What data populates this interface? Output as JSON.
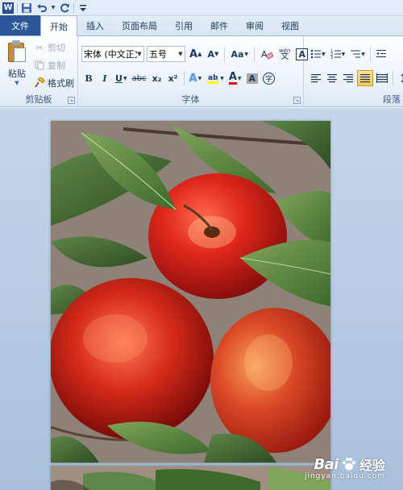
{
  "qat": {
    "app_letter": "W"
  },
  "tabs": [
    {
      "label": "文件"
    },
    {
      "label": "开始"
    },
    {
      "label": "插入"
    },
    {
      "label": "页面布局"
    },
    {
      "label": "引用"
    },
    {
      "label": "邮件"
    },
    {
      "label": "审阅"
    },
    {
      "label": "视图"
    }
  ],
  "clipboard": {
    "paste_label": "粘贴",
    "cut_label": "剪切",
    "copy_label": "复制",
    "format_painter_label": "格式刷",
    "group_label": "剪贴板"
  },
  "font": {
    "font_name": "宋体 (中文正文",
    "font_size": "五号",
    "grow": "A",
    "shrink": "A",
    "change_case": "Aa",
    "pinyin": "wén",
    "bold": "B",
    "italic": "I",
    "underline": "U",
    "strike": "abc",
    "subscript": "x₂",
    "superscript": "x²",
    "text_effects": "A",
    "font_color": "A",
    "char_shading": "A",
    "enclose": "字",
    "group_label": "字体"
  },
  "paragraph": {
    "group_label": "段落"
  },
  "watermark": {
    "brand": "Bai",
    "brand_cn": "经验",
    "sub": "jingyan.baidu.com"
  },
  "colors": {
    "file_tab": "#2b579a",
    "ribbon_bg": "#eaf1fa",
    "doc_bg": "#b8cce4",
    "highlight": "#f8c85a"
  }
}
